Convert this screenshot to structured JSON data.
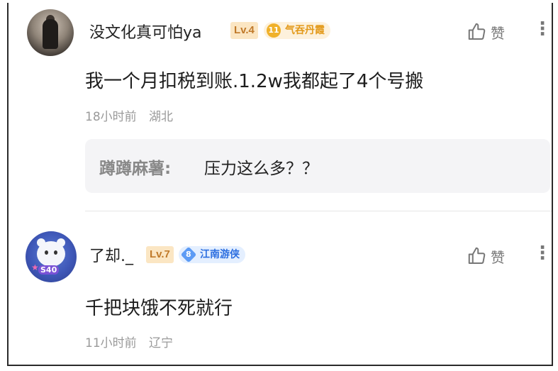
{
  "comments": [
    {
      "username": "没文化真可怕ya",
      "level": "Lv.4",
      "fan_badge": {
        "number": "11",
        "name": "气吞丹霞",
        "color": "#e39a1b"
      },
      "like_label": "赞",
      "text": "我一个月扣税到账.1.2w我都起了4个号搬",
      "time": "18小时前",
      "location": "湖北",
      "reply": {
        "author": "蹲蹲麻薯:",
        "text": "压力这么多？？"
      }
    },
    {
      "username": "了却._",
      "level": "Lv.7",
      "fan_badge": {
        "number": "8",
        "name": "江南游侠",
        "color": "#2d6fe0"
      },
      "avatar_badge": "S40",
      "like_label": "赞",
      "text": "千把块饿不死就行",
      "time": "11小时前",
      "location": "辽宁"
    }
  ],
  "icons": {
    "like": "thumbs-up-icon",
    "more": "more-vertical-icon"
  }
}
